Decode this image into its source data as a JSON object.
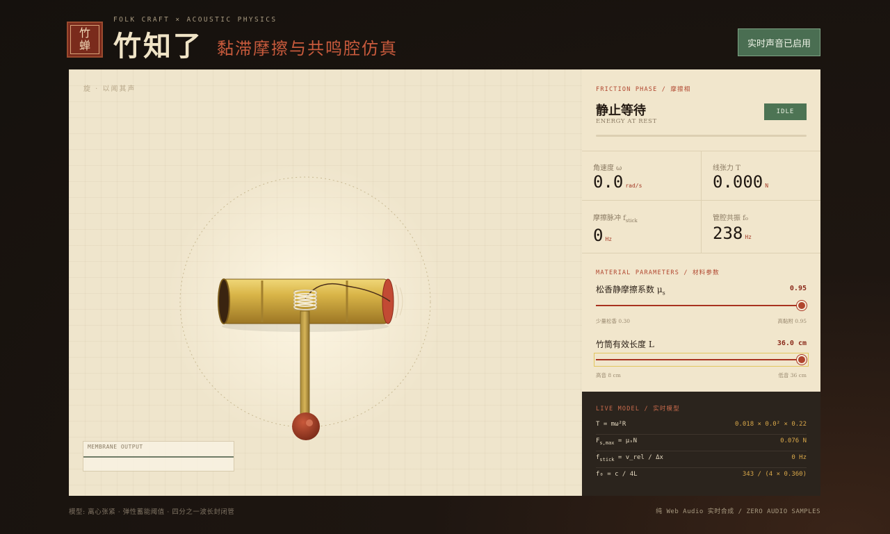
{
  "header": {
    "seal_top": "竹",
    "seal_bottom": "蝉",
    "eyebrow": "FOLK CRAFT × ACOUSTIC PHYSICS",
    "title": "竹知了",
    "subtitle": "黏滞摩擦与共鸣腔仿真",
    "audio_button_label": "实时声音已启用"
  },
  "stage": {
    "hint": "旋 · 以闻其声",
    "membrane_label": "MEMBRANE OUTPUT"
  },
  "phase": {
    "section_label": "FRICTION PHASE / 摩擦相",
    "title": "静止等待",
    "subtitle": "ENERGY AT REST",
    "badge": "IDLE",
    "energy_level": 0
  },
  "metrics": {
    "angular_velocity": {
      "label": "角速度 ω",
      "value": "0.0",
      "unit": "rad/s"
    },
    "tension": {
      "label": "线张力 T",
      "value": "0.000",
      "unit": "N"
    },
    "stick_pulse": {
      "label_main": "摩擦脉冲 f",
      "label_sub": "stick",
      "value": "0",
      "unit": "Hz"
    },
    "resonance": {
      "label": "管腔共振 f₀",
      "value": "238",
      "unit": "Hz"
    }
  },
  "params": {
    "section_label": "MATERIAL PARAMETERS / 材料参数",
    "friction": {
      "name_main": "松香静摩擦系数 μ",
      "name_sub": "s",
      "value": "0.95",
      "level": 1.0,
      "min_label": "少量松香 0.30",
      "max_label": "高黏附 0.95"
    },
    "length": {
      "name": "竹筒有效长度 L",
      "value": "36.0 cm",
      "level": 1.0,
      "min_label": "高音 8 cm",
      "max_label": "低音 36 cm"
    }
  },
  "model": {
    "section_label": "LIVE MODEL / 实时模型",
    "rows": [
      {
        "eq_main": "T = mω²R",
        "eq_sub": "",
        "eq_tail": "",
        "value": "0.018 × 0.0² × 0.22"
      },
      {
        "eq_main": "F",
        "eq_sub": "s,max",
        "eq_tail": " = μₛN",
        "value": "0.076 N"
      },
      {
        "eq_main": "f",
        "eq_sub": "stick",
        "eq_tail": " = v_rel / Δx",
        "value": "0 Hz"
      },
      {
        "eq_main": "f₀ = c / 4L",
        "eq_sub": "",
        "eq_tail": "",
        "value": "343 / (4 × 0.360)"
      }
    ]
  },
  "footer": {
    "left": "模型: 离心张紧 · 弹性蓄能阈值 · 四分之一波长封闭管",
    "right": "纯 Web Audio 实时合成 / ZERO AUDIO SAMPLES"
  },
  "colors": {
    "accent_red": "#b0452e",
    "accent_green": "#4d7454",
    "bamboo_gold": "#c9a23a"
  }
}
